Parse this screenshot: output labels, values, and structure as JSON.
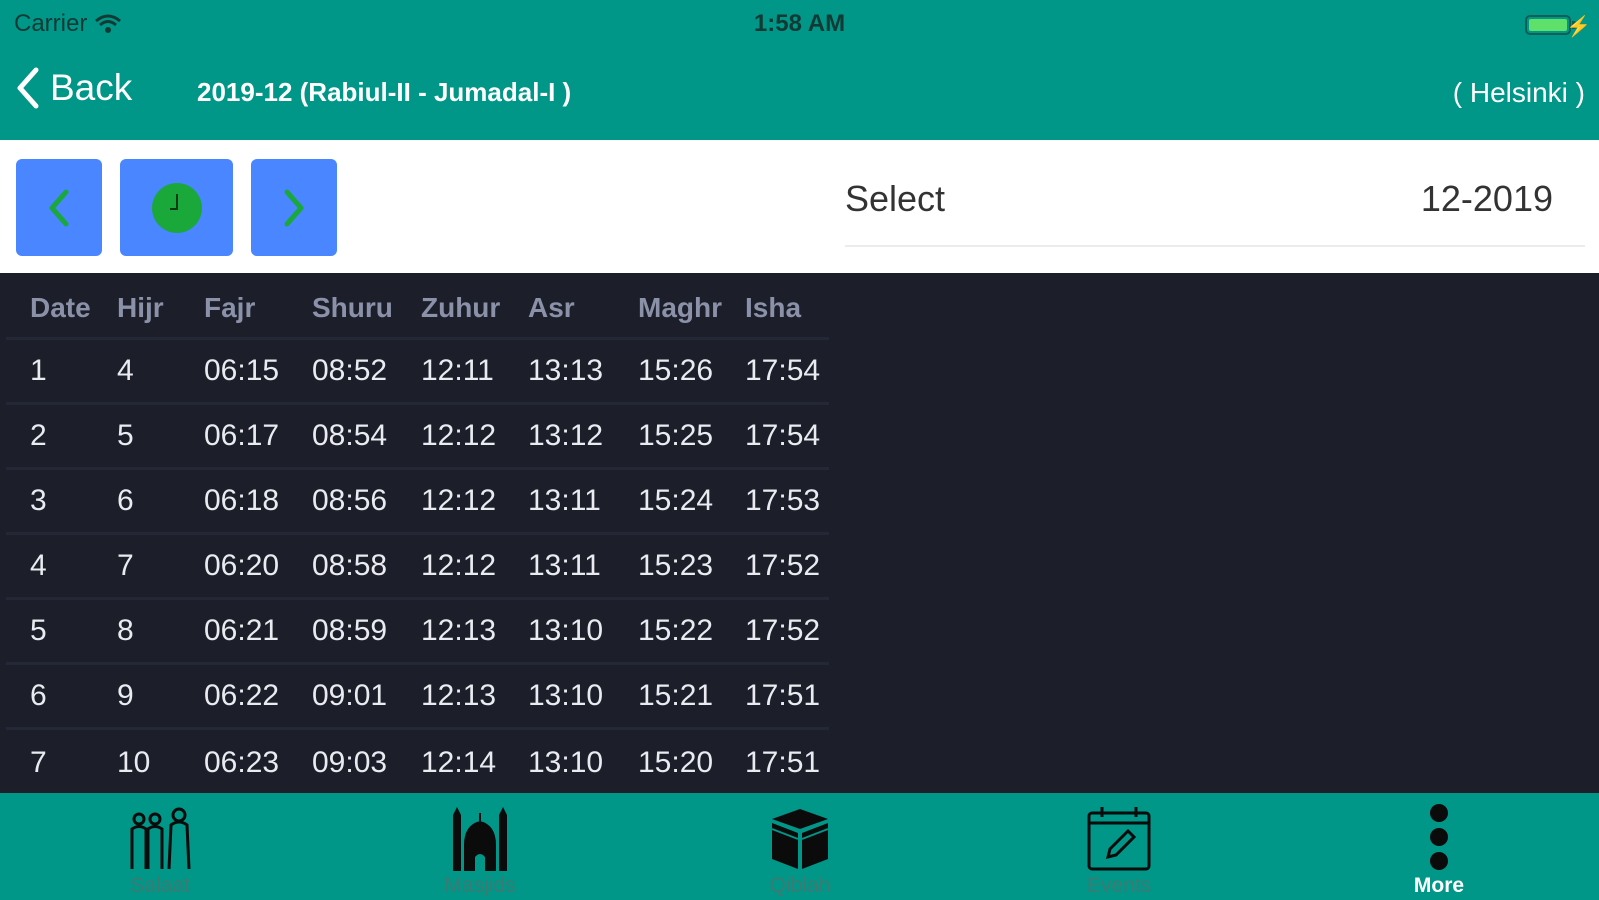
{
  "status_bar": {
    "carrier": "Carrier",
    "time": "1:58 AM"
  },
  "nav": {
    "back_label": "Back",
    "title": "2019-12 (Rabiul-II - Jumadal-I )",
    "city": "( Helsinki )"
  },
  "toolbar": {
    "select_label": "Select",
    "select_value": "12-2019"
  },
  "table": {
    "headers": [
      "Date",
      "Hijr",
      "Fajr",
      "Shuru",
      "Zuhur",
      "Asr",
      "Maghr",
      "Isha"
    ],
    "rows": [
      [
        "1",
        "4",
        "06:15",
        "08:52",
        "12:11",
        "13:13",
        "15:26",
        "17:54"
      ],
      [
        "2",
        "5",
        "06:17",
        "08:54",
        "12:12",
        "13:12",
        "15:25",
        "17:54"
      ],
      [
        "3",
        "6",
        "06:18",
        "08:56",
        "12:12",
        "13:11",
        "15:24",
        "17:53"
      ],
      [
        "4",
        "7",
        "06:20",
        "08:58",
        "12:12",
        "13:11",
        "15:23",
        "17:52"
      ],
      [
        "5",
        "8",
        "06:21",
        "08:59",
        "12:13",
        "13:10",
        "15:22",
        "17:52"
      ],
      [
        "6",
        "9",
        "06:22",
        "09:01",
        "12:13",
        "13:10",
        "15:21",
        "17:51"
      ],
      [
        "7",
        "10",
        "06:23",
        "09:03",
        "12:14",
        "13:10",
        "15:20",
        "17:51"
      ]
    ]
  },
  "tabs": [
    {
      "label": "Salaat",
      "icon": "people-praying-icon"
    },
    {
      "label": "Masjids",
      "icon": "mosque-icon"
    },
    {
      "label": "Qiblah",
      "icon": "kaaba-icon"
    },
    {
      "label": "Events",
      "icon": "calendar-edit-icon"
    },
    {
      "label": "More",
      "icon": "more-dots-icon"
    }
  ],
  "colors": {
    "brand": "#009688",
    "button": "#4a86ff",
    "table_bg": "#1c1f2a",
    "clock_green": "#1aa83a"
  }
}
